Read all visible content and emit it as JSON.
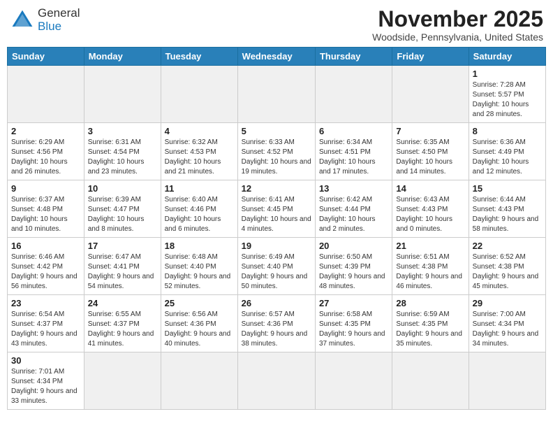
{
  "header": {
    "logo_general": "General",
    "logo_blue": "Blue",
    "month_title": "November 2025",
    "location": "Woodside, Pennsylvania, United States"
  },
  "days_of_week": [
    "Sunday",
    "Monday",
    "Tuesday",
    "Wednesday",
    "Thursday",
    "Friday",
    "Saturday"
  ],
  "weeks": [
    [
      {
        "day": "",
        "info": ""
      },
      {
        "day": "",
        "info": ""
      },
      {
        "day": "",
        "info": ""
      },
      {
        "day": "",
        "info": ""
      },
      {
        "day": "",
        "info": ""
      },
      {
        "day": "",
        "info": ""
      },
      {
        "day": "1",
        "info": "Sunrise: 7:28 AM\nSunset: 5:57 PM\nDaylight: 10 hours and 28 minutes."
      }
    ],
    [
      {
        "day": "2",
        "info": "Sunrise: 6:29 AM\nSunset: 4:56 PM\nDaylight: 10 hours and 26 minutes."
      },
      {
        "day": "3",
        "info": "Sunrise: 6:31 AM\nSunset: 4:54 PM\nDaylight: 10 hours and 23 minutes."
      },
      {
        "day": "4",
        "info": "Sunrise: 6:32 AM\nSunset: 4:53 PM\nDaylight: 10 hours and 21 minutes."
      },
      {
        "day": "5",
        "info": "Sunrise: 6:33 AM\nSunset: 4:52 PM\nDaylight: 10 hours and 19 minutes."
      },
      {
        "day": "6",
        "info": "Sunrise: 6:34 AM\nSunset: 4:51 PM\nDaylight: 10 hours and 17 minutes."
      },
      {
        "day": "7",
        "info": "Sunrise: 6:35 AM\nSunset: 4:50 PM\nDaylight: 10 hours and 14 minutes."
      },
      {
        "day": "8",
        "info": "Sunrise: 6:36 AM\nSunset: 4:49 PM\nDaylight: 10 hours and 12 minutes."
      }
    ],
    [
      {
        "day": "9",
        "info": "Sunrise: 6:37 AM\nSunset: 4:48 PM\nDaylight: 10 hours and 10 minutes."
      },
      {
        "day": "10",
        "info": "Sunrise: 6:39 AM\nSunset: 4:47 PM\nDaylight: 10 hours and 8 minutes."
      },
      {
        "day": "11",
        "info": "Sunrise: 6:40 AM\nSunset: 4:46 PM\nDaylight: 10 hours and 6 minutes."
      },
      {
        "day": "12",
        "info": "Sunrise: 6:41 AM\nSunset: 4:45 PM\nDaylight: 10 hours and 4 minutes."
      },
      {
        "day": "13",
        "info": "Sunrise: 6:42 AM\nSunset: 4:44 PM\nDaylight: 10 hours and 2 minutes."
      },
      {
        "day": "14",
        "info": "Sunrise: 6:43 AM\nSunset: 4:43 PM\nDaylight: 10 hours and 0 minutes."
      },
      {
        "day": "15",
        "info": "Sunrise: 6:44 AM\nSunset: 4:43 PM\nDaylight: 9 hours and 58 minutes."
      }
    ],
    [
      {
        "day": "16",
        "info": "Sunrise: 6:46 AM\nSunset: 4:42 PM\nDaylight: 9 hours and 56 minutes."
      },
      {
        "day": "17",
        "info": "Sunrise: 6:47 AM\nSunset: 4:41 PM\nDaylight: 9 hours and 54 minutes."
      },
      {
        "day": "18",
        "info": "Sunrise: 6:48 AM\nSunset: 4:40 PM\nDaylight: 9 hours and 52 minutes."
      },
      {
        "day": "19",
        "info": "Sunrise: 6:49 AM\nSunset: 4:40 PM\nDaylight: 9 hours and 50 minutes."
      },
      {
        "day": "20",
        "info": "Sunrise: 6:50 AM\nSunset: 4:39 PM\nDaylight: 9 hours and 48 minutes."
      },
      {
        "day": "21",
        "info": "Sunrise: 6:51 AM\nSunset: 4:38 PM\nDaylight: 9 hours and 46 minutes."
      },
      {
        "day": "22",
        "info": "Sunrise: 6:52 AM\nSunset: 4:38 PM\nDaylight: 9 hours and 45 minutes."
      }
    ],
    [
      {
        "day": "23",
        "info": "Sunrise: 6:54 AM\nSunset: 4:37 PM\nDaylight: 9 hours and 43 minutes."
      },
      {
        "day": "24",
        "info": "Sunrise: 6:55 AM\nSunset: 4:37 PM\nDaylight: 9 hours and 41 minutes."
      },
      {
        "day": "25",
        "info": "Sunrise: 6:56 AM\nSunset: 4:36 PM\nDaylight: 9 hours and 40 minutes."
      },
      {
        "day": "26",
        "info": "Sunrise: 6:57 AM\nSunset: 4:36 PM\nDaylight: 9 hours and 38 minutes."
      },
      {
        "day": "27",
        "info": "Sunrise: 6:58 AM\nSunset: 4:35 PM\nDaylight: 9 hours and 37 minutes."
      },
      {
        "day": "28",
        "info": "Sunrise: 6:59 AM\nSunset: 4:35 PM\nDaylight: 9 hours and 35 minutes."
      },
      {
        "day": "29",
        "info": "Sunrise: 7:00 AM\nSunset: 4:34 PM\nDaylight: 9 hours and 34 minutes."
      }
    ],
    [
      {
        "day": "30",
        "info": "Sunrise: 7:01 AM\nSunset: 4:34 PM\nDaylight: 9 hours and 33 minutes."
      },
      {
        "day": "",
        "info": ""
      },
      {
        "day": "",
        "info": ""
      },
      {
        "day": "",
        "info": ""
      },
      {
        "day": "",
        "info": ""
      },
      {
        "day": "",
        "info": ""
      },
      {
        "day": "",
        "info": ""
      }
    ]
  ]
}
